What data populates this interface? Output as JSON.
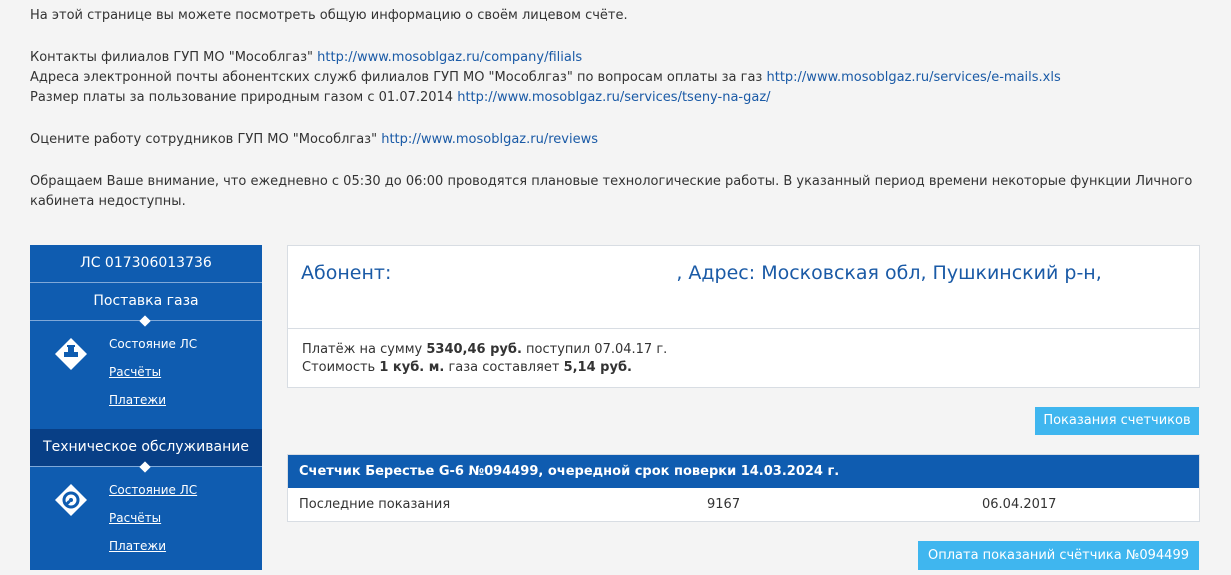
{
  "intro": {
    "line1": "На этой странице вы можете посмотреть общую информацию о своём лицевом счёте.",
    "contacts_label": "Контакты филиалов ГУП МО \"Мособлгаз\"",
    "contacts_link": "http://www.mosoblgaz.ru/company/filials",
    "emails_label": "Адреса электронной почты абонентских служб филиалов ГУП МО \"Мособлгаз\" по вопросам оплаты за газ",
    "emails_link": "http://www.mosoblgaz.ru/services/e-mails.xls",
    "price_label": "Размер платы за пользование природным газом с 01.07.2014",
    "price_link": "http://www.mosoblgaz.ru/services/tseny-na-gaz/",
    "review_label": "Оцените работу сотрудников ГУП МО \"Мособлгаз\"",
    "review_link": "http://www.mosoblgaz.ru/reviews",
    "notice": "Обращаем Ваше внимание, что ежедневно с 05:30 до 06:00 проводятся плановые технологические работы. В указанный период времени некоторые функции Личного кабинета недоступны."
  },
  "sidebar": {
    "account": "ЛС 017306013736",
    "section1": {
      "title": "Поставка газа",
      "icon": "gas-valve-icon",
      "items": [
        "Состояние ЛС",
        "Расчёты",
        "Платежи"
      ]
    },
    "section2": {
      "title": "Техническое обслуживание",
      "icon": "maintenance-gear-icon",
      "items": [
        "Состояние ЛС",
        "Расчёты",
        "Платежи"
      ]
    }
  },
  "abonent": {
    "prefix": "Абонент:",
    "address": ", Адрес: Московская обл, Пушкинский р-н,"
  },
  "payment": {
    "p1": "Платёж на сумму",
    "amount": "5340,46 руб.",
    "p2": "поступил 07.04.17 г.",
    "c1": "Стоимость",
    "unit": "1 куб. м.",
    "c2": "газа составляет",
    "price": "5,14 руб."
  },
  "buttons": {
    "readings": "Показания счетчиков",
    "pay_readings": "Оплата показаний счётчика №094499"
  },
  "meter": {
    "header": "Счетчик Берестье G-6 №094499, очередной срок поверки 14.03.2024 г.",
    "row_label": "Последние показания",
    "row_value": "9167",
    "row_date": "06.04.2017"
  },
  "colors": {
    "brand_blue": "#0f5cb0",
    "button_blue": "#3fb6ef",
    "link": "#1a5aa6"
  }
}
